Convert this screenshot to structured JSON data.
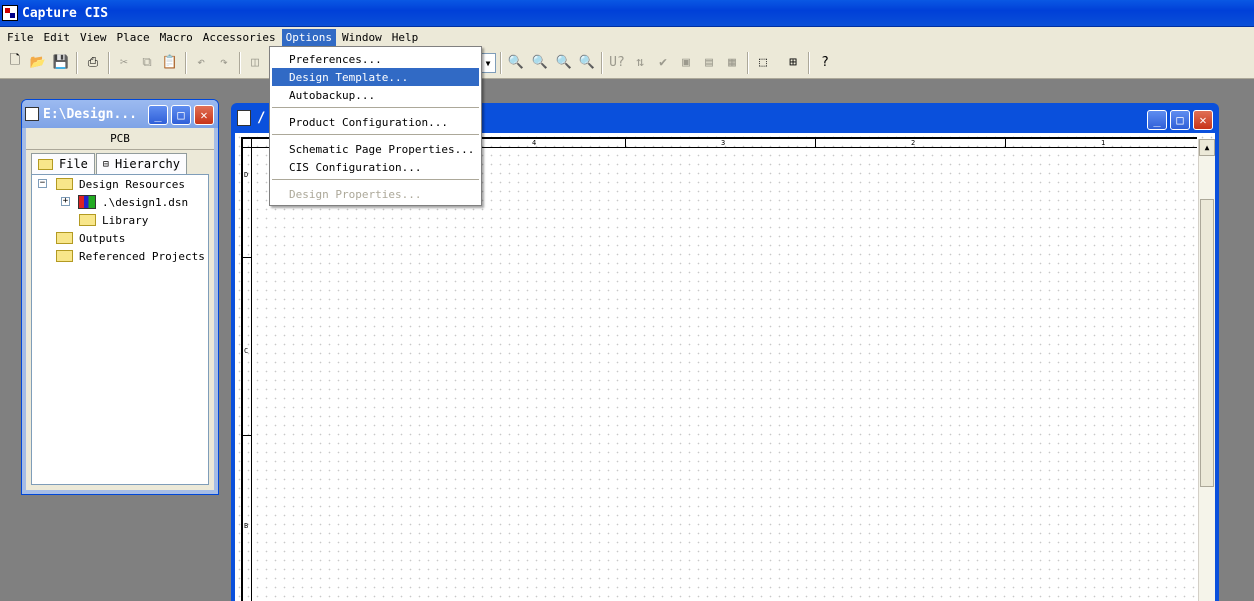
{
  "app": {
    "title": "Capture CIS"
  },
  "menubar": {
    "items": [
      {
        "key": "file",
        "label": "File"
      },
      {
        "key": "edit",
        "label": "Edit"
      },
      {
        "key": "view",
        "label": "View"
      },
      {
        "key": "place",
        "label": "Place"
      },
      {
        "key": "macro",
        "label": "Macro"
      },
      {
        "key": "accessories",
        "label": "Accessories"
      },
      {
        "key": "options",
        "label": "Options"
      },
      {
        "key": "window",
        "label": "Window"
      },
      {
        "key": "help",
        "label": "Help"
      }
    ],
    "active": "Options"
  },
  "options_menu": {
    "items": [
      {
        "label": "Preferences...",
        "state": "normal"
      },
      {
        "label": "Design Template...",
        "state": "highlighted"
      },
      {
        "label": "Autobackup...",
        "state": "normal"
      },
      {
        "label": "Product Configuration...",
        "state": "normal"
      },
      {
        "label": "Schematic Page Properties...",
        "state": "normal"
      },
      {
        "label": "CIS Configuration...",
        "state": "normal"
      },
      {
        "label": "Design Properties...",
        "state": "disabled"
      }
    ]
  },
  "project_window": {
    "title": "E:\\Design...",
    "category": "PCB",
    "tabs": [
      {
        "label": "File",
        "active": true
      },
      {
        "label": "Hierarchy",
        "active": false
      }
    ],
    "tree": [
      {
        "label": "Design Resources",
        "level": 0,
        "icon": "folder-icon",
        "expander": "-"
      },
      {
        "label": ".\\design1.dsn",
        "level": 1,
        "icon": "design-file-icon",
        "expander": "+"
      },
      {
        "label": "Library",
        "level": 2,
        "icon": "folder-icon"
      },
      {
        "label": "Outputs",
        "level": 0,
        "icon": "folder-icon"
      },
      {
        "label": "Referenced Projects",
        "level": 0,
        "icon": "folder-icon"
      }
    ]
  },
  "schematic_window": {
    "title": "/",
    "column_zones": [
      "4",
      "3",
      "2",
      "1"
    ],
    "row_zones": [
      "D",
      "C",
      "B"
    ]
  }
}
